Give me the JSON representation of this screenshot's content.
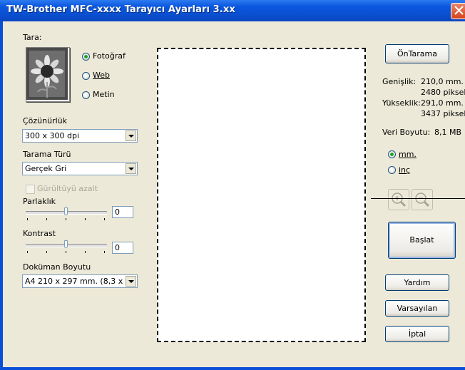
{
  "window": {
    "title": "TW-Brother MFC-xxxx  Tarayıcı Ayarları   3.xx"
  },
  "scan": {
    "label": "Tara:",
    "options": [
      {
        "label": "Fotoğraf",
        "selected": true
      },
      {
        "label": "Web",
        "selected": false
      },
      {
        "label": "Metin",
        "selected": false
      }
    ]
  },
  "resolution": {
    "label": "Çözünürlük",
    "value": "300 x 300 dpi"
  },
  "scan_type": {
    "label": "Tarama Türü",
    "value": "Gerçek Gri"
  },
  "noise": {
    "label": "Gürültüyü azalt",
    "checked": false,
    "enabled": false
  },
  "brightness": {
    "label": "Parlaklık",
    "value": "0"
  },
  "contrast": {
    "label": "Kontrast",
    "value": "0"
  },
  "document_size": {
    "label": "Doküman Boyutu",
    "value": "A4 210 x 297 mm. (8,3 x 11"
  },
  "prescan": {
    "label": "ÖnTarama"
  },
  "info": {
    "width_label": "Genişlik:",
    "width_mm": "210,0 mm.",
    "width_px": "2480 piksel",
    "height_label": "Yükseklik:",
    "height_mm": "291,0 mm.",
    "height_px": "3437 piksel",
    "data_size_label": "Veri Boyutu:",
    "data_size": "8,1 MB"
  },
  "units": [
    {
      "label": "mm.",
      "selected": true
    },
    {
      "label": "inç",
      "selected": false
    }
  ],
  "buttons": {
    "start": "Başlat",
    "help": "Yardım",
    "defaults": "Varsayılan",
    "cancel": "İptal"
  }
}
